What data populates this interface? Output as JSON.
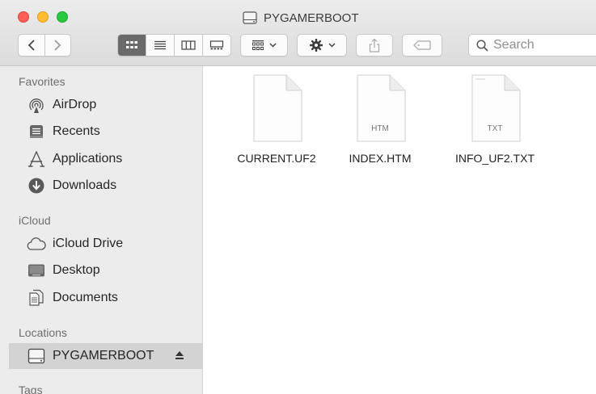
{
  "window": {
    "title": "PYGAMERBOOT"
  },
  "toolbar": {
    "search_placeholder": "Search"
  },
  "sidebar": {
    "sections": {
      "favorites": "Favorites",
      "icloud": "iCloud",
      "locations": "Locations",
      "tags": "Tags"
    },
    "favorites": [
      {
        "label": "AirDrop",
        "icon": "airdrop-icon"
      },
      {
        "label": "Recents",
        "icon": "recents-icon"
      },
      {
        "label": "Applications",
        "icon": "applications-icon"
      },
      {
        "label": "Downloads",
        "icon": "downloads-icon"
      }
    ],
    "icloud": [
      {
        "label": "iCloud Drive",
        "icon": "cloud-icon"
      },
      {
        "label": "Desktop",
        "icon": "desktop-icon"
      },
      {
        "label": "Documents",
        "icon": "documents-icon"
      }
    ],
    "locations": [
      {
        "label": "PYGAMERBOOT",
        "icon": "drive-icon",
        "selected": true
      }
    ]
  },
  "files": [
    {
      "name": "CURRENT.UF2",
      "ext_badge": ""
    },
    {
      "name": "INDEX.HTM",
      "ext_badge": "HTM"
    },
    {
      "name": "INFO_UF2.TXT",
      "ext_badge": "TXT"
    }
  ],
  "colors": {
    "selection": "#d3d3d3",
    "sidebar_bg": "#ececec",
    "active_view": "#6a6a6a"
  }
}
